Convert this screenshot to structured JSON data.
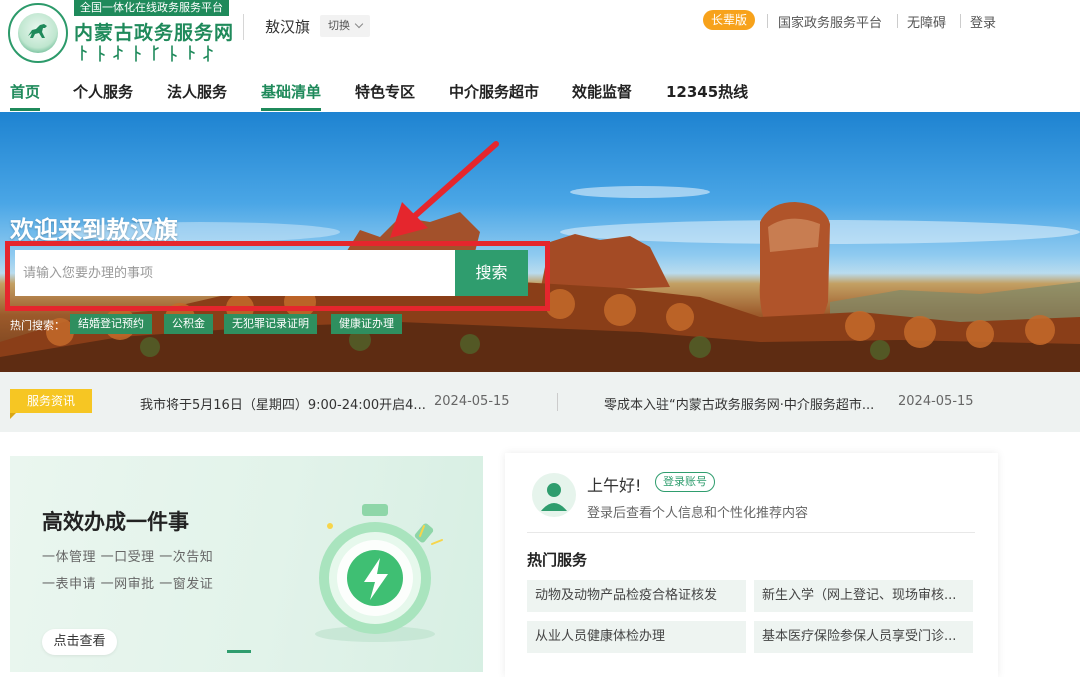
{
  "header": {
    "logo_tagline": "全国一体化在线政务服务平台",
    "logo_title": "内蒙古政务服务网",
    "region_name": "敖汉旗",
    "region_switch_label": "切换",
    "elder_mode_label": "长辈版",
    "links": [
      "国家政务服务平台",
      "无障碍",
      "登录"
    ]
  },
  "nav": {
    "items": [
      "首页",
      "个人服务",
      "法人服务",
      "基础清单",
      "特色专区",
      "中介服务超市",
      "效能监督",
      "12345热线"
    ],
    "active_items": [
      "首页",
      "基础清单"
    ]
  },
  "hero": {
    "title": "欢迎来到敖汉旗",
    "search_placeholder": "请输入您要办理的事项",
    "search_button": "搜索",
    "hot_label": "热门搜索：",
    "hot_tags": [
      "结婚登记预约",
      "公积金",
      "无犯罪记录证明",
      "健康证办理"
    ]
  },
  "news": {
    "badge": "服务资讯",
    "items": [
      {
        "title": "我市将于5月16日（星期四）9:00-24:00开启4...",
        "date": "2024-05-15"
      },
      {
        "title": "零成本入驻“内蒙古政务服务网·中介服务超市...",
        "date": "2024-05-15"
      }
    ]
  },
  "promo": {
    "title": "高效办成一件事",
    "line1": "一体管理 一口受理 一次告知",
    "line2": "一表申请 一网审批 一窗发证",
    "button": "点击查看"
  },
  "user_panel": {
    "greeting": "上午好!",
    "login_button": "登录账号",
    "subtitle": "登录后查看个人信息和个性化推荐内容",
    "hot_services_title": "热门服务",
    "services": [
      "动物及动物产品检疫合格证核发",
      "新生入学（网上登记、现场审核...",
      "从业人员健康体检办理",
      "基本医疗保险参保人员享受门诊..."
    ]
  },
  "colors": {
    "brand_green": "#1f8a5b",
    "button_green": "#2f9d6e",
    "elder_orange": "#f7a21b",
    "news_badge_yellow": "#f6c623",
    "highlight_red": "#e5262d"
  }
}
